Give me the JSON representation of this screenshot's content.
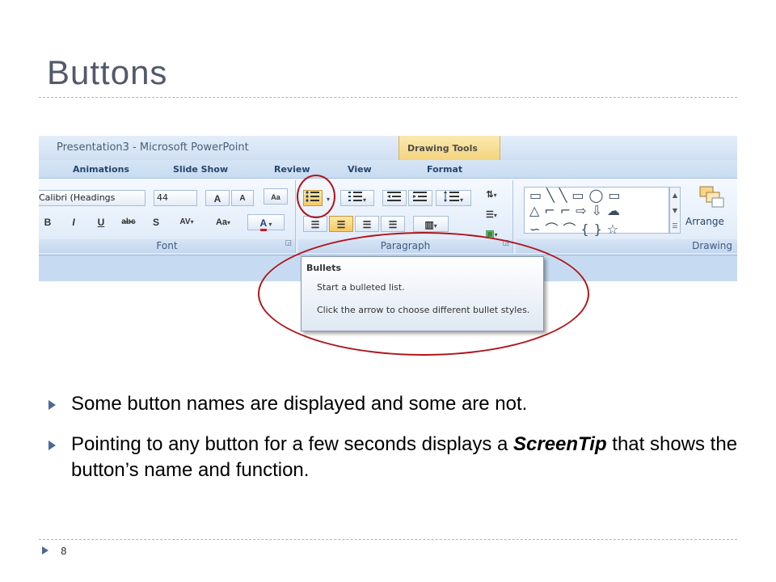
{
  "slide": {
    "title": "Buttons",
    "page_number": "8",
    "bullets": [
      {
        "text": "Some button names are displayed and some are not."
      },
      {
        "pre": "Pointing to any button for a few seconds displays a ",
        "em": "ScreenTip",
        "post": " that shows the button’s name and function."
      }
    ]
  },
  "window": {
    "title": "Presentation3 - Microsoft PowerPoint",
    "context_header": "Drawing Tools"
  },
  "tabs": [
    "Animations",
    "Slide Show",
    "Review",
    "View",
    "Format"
  ],
  "font_group": {
    "label": "Font",
    "font_name": "Calibri (Headings",
    "font_size": "44",
    "grow_icon": "A",
    "shrink_icon": "A",
    "clear_icon": "Aa",
    "bold": "B",
    "italic": "I",
    "underline": "U",
    "strike": "abc",
    "shadow": "S",
    "spacing": "AV",
    "change_case": "Aa",
    "font_color": "A"
  },
  "paragraph_group": {
    "label": "Paragraph"
  },
  "drawing_group": {
    "label": "Drawing",
    "arrange_label": "Arrange",
    "shapes_row1": "▭╲╲▭◯▭",
    "shapes_row2": "△⌐⌐⇨⇩☁",
    "shapes_row3": "∽⌒⌒{}☆"
  },
  "screentip": {
    "title": "Bullets",
    "line1": "Start a bulleted list.",
    "line2": "Click the arrow to choose different bullet styles."
  },
  "colors": {
    "title_text": "#52596b",
    "callout_ring": "#b0161c",
    "bullet_marker": "#4c6a93",
    "ribbon": "#dce9f8",
    "context_tab": "#f4d47d"
  }
}
